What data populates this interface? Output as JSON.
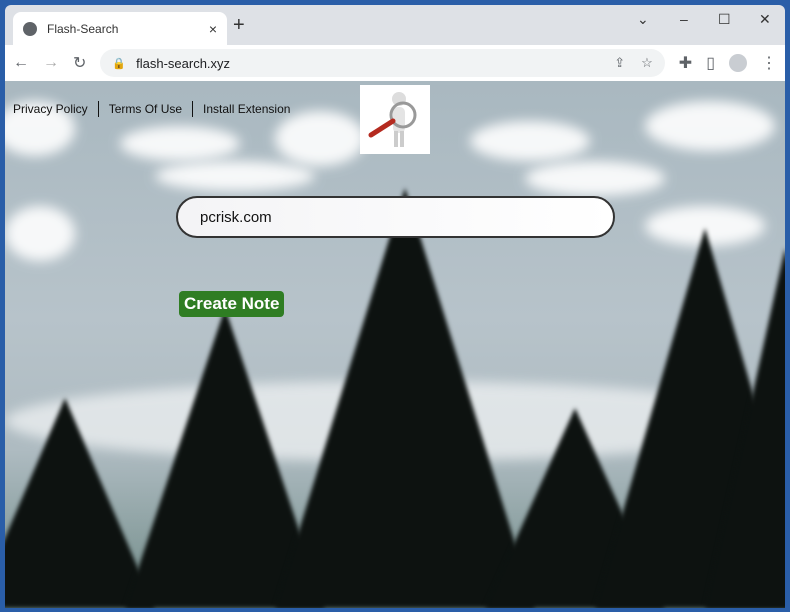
{
  "browser": {
    "tab_title": "Flash-Search",
    "url": "flash-search.xyz",
    "new_tab": "+",
    "close_tab": "×",
    "window_controls": {
      "dropdown": "⌄",
      "minimize": "–",
      "maximize": "☐",
      "close": "✕"
    }
  },
  "page": {
    "links": [
      "Privacy Policy",
      "Terms Of Use",
      "Install Extension"
    ],
    "search": {
      "value": "pcrisk.com"
    },
    "create_note": "Create Note"
  },
  "colors": {
    "button": "#2f7d23",
    "frame": "#2a5ea8"
  }
}
